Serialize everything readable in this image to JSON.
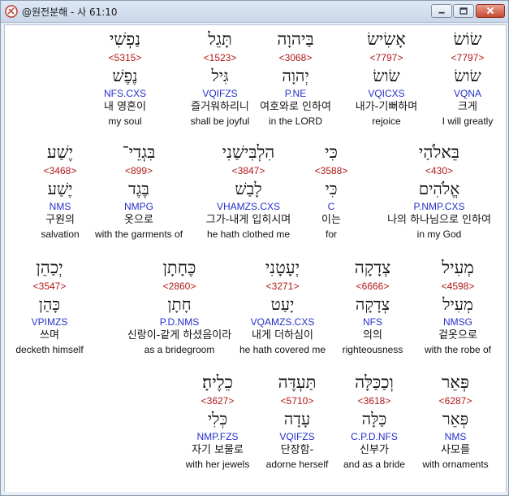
{
  "window": {
    "title": "@원전분해 - 사 61:10",
    "controls": {
      "minimize": "minimize",
      "maximize": "maximize",
      "close": "close"
    }
  },
  "rows": [
    [
      {
        "hebrew": "שׂוֹשׂ",
        "strong": "<7797>",
        "lemma": "שׂושׂ",
        "morph": "VQNA",
        "korean": "크게",
        "english": "I will greatly",
        "selected": true
      },
      {
        "hebrew": "אָשִׂישׂ",
        "strong": "<7797>",
        "lemma": "שׂושׂ",
        "morph": "VQICXS",
        "korean": "내가-기뻐하며",
        "english": "rejoice"
      },
      {
        "hebrew": "בַּיהוָה",
        "strong": "<3068>",
        "lemma": "יְהוָה",
        "morph": "P.NE",
        "korean": "여호와로 인하여",
        "english": "in the LORD"
      },
      {
        "hebrew": "תָּגֵל",
        "strong": "<1523>",
        "lemma": "גִּיל",
        "morph": "VQIFZS",
        "korean": "즐거워하리니",
        "english": "shall be joyful"
      },
      {
        "hebrew": "נַפְשִׁי",
        "strong": "<5315>",
        "lemma": "נֶפֶשׁ",
        "morph": "NFS.CXS",
        "korean": "내 영혼이",
        "english": "my soul"
      }
    ],
    [
      {
        "hebrew": "בֵּאלֹהַי",
        "strong": "<430>",
        "lemma": "אֱלֹהִים",
        "morph": "P.NMP.CXS",
        "korean": "나의 하나님으로 인하여",
        "english": "in my God"
      },
      {
        "hebrew": "כִּי",
        "strong": "<3588>",
        "lemma": "כִּי",
        "morph": "C",
        "korean": "이는",
        "english": "for"
      },
      {
        "hebrew": "הִלְבִּישַׁנִי",
        "strong": "<3847>",
        "lemma": "לָבַשׁ",
        "morph": "VHAMZS.CXS",
        "korean": "그가-내게 입히시며",
        "english": "he hath clothed me"
      },
      {
        "hebrew": "בִּגְדֵי־",
        "strong": "<899>",
        "lemma": "בֶּגֶד",
        "morph": "NMPG",
        "korean": "옷으로",
        "english": "with the garments of"
      },
      {
        "hebrew": "יֶשַׁע",
        "strong": "<3468>",
        "lemma": "יֶשַׁע",
        "morph": "NMS",
        "korean": "구원의",
        "english": "salvation"
      }
    ],
    [
      {
        "hebrew": "מְעִיל",
        "strong": "<4598>",
        "lemma": "מְעִיל",
        "morph": "NMSG",
        "korean": "겉옷으로",
        "english": "with the robe of"
      },
      {
        "hebrew": "צְדָקָה",
        "strong": "<6666>",
        "lemma": "צְדָקָה",
        "morph": "NFS",
        "korean": "의의",
        "english": "righteousness"
      },
      {
        "hebrew": "יְעָטָנִי",
        "strong": "<3271>",
        "lemma": "יָעַט",
        "morph": "VQAMZS.CXS",
        "korean": "내게 더하심이",
        "english": "he hath covered me"
      },
      {
        "hebrew": "כֶּחָתָן",
        "strong": "<2860>",
        "lemma": "חָתָן",
        "morph": "P.D.NMS",
        "korean": "신랑이-같게 하셨음이라",
        "english": "as a bridegroom"
      },
      {
        "hebrew": "יְכַהֵן",
        "strong": "<3547>",
        "lemma": "כָּהַן",
        "morph": "VPIMZS",
        "korean": "쓰며",
        "english": "decketh himself"
      }
    ],
    [
      {
        "hebrew": "פְּאֵר",
        "strong": "<6287>",
        "lemma": "פְּאֵר",
        "morph": "NMS",
        "korean": "사모를",
        "english": "with ornaments"
      },
      {
        "hebrew": "וְכַכַּלָּה",
        "strong": "<3618>",
        "lemma": "כַּלָּה",
        "morph": "C.P.D.NFS",
        "korean": "신부가",
        "english": "and as a bride"
      },
      {
        "hebrew": "תַּעְדֶּה",
        "strong": "<5710>",
        "lemma": "עָדָה",
        "morph": "VQIFZS",
        "korean": "단장함-",
        "english": "adorne herself"
      },
      {
        "hebrew": "כֵלֶיהָ׃",
        "strong": "<3627>",
        "lemma": "כְּלִי",
        "morph": "NMP.FZS",
        "korean": "자기 보물로",
        "english": "with her jewels"
      }
    ]
  ]
}
